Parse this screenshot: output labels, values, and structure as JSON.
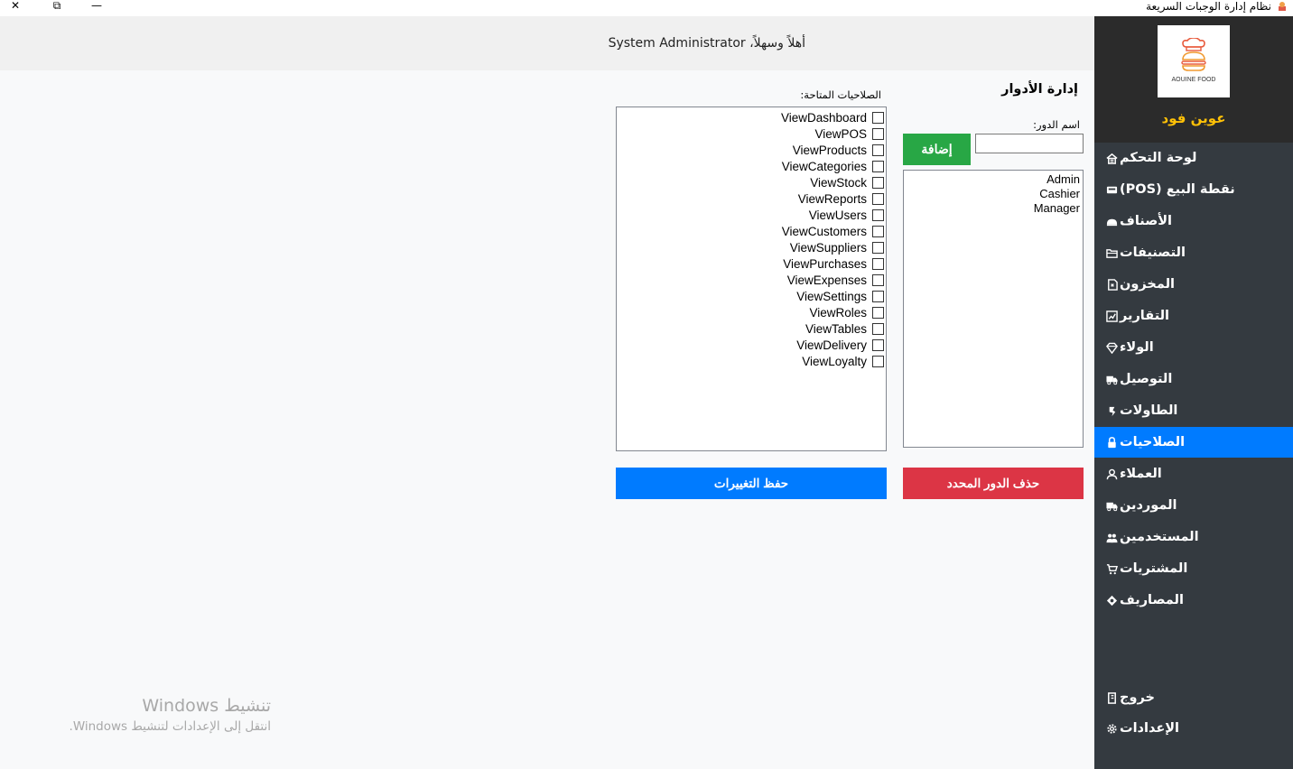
{
  "window": {
    "title": "نظام إدارة الوجبات السريعة",
    "close_glyph": "✕",
    "restore_glyph": "⧉",
    "minimize_glyph": "—"
  },
  "header": {
    "welcome": "أهلاً وسهلاً، System Administrator"
  },
  "sidebar": {
    "logo_text": "AOUINE FOOD",
    "brand": "عوين فود",
    "items": [
      {
        "label": "لوحة التحكم",
        "icon": "home-icon"
      },
      {
        "label": "نقطة البيع (POS)",
        "icon": "pos-icon"
      },
      {
        "label": "الأصناف",
        "icon": "food-icon"
      },
      {
        "label": "التصنيفات",
        "icon": "folder-icon"
      },
      {
        "label": "المخزون",
        "icon": "stock-icon"
      },
      {
        "label": "التقارير",
        "icon": "report-icon"
      },
      {
        "label": "الولاء",
        "icon": "diamond-icon"
      },
      {
        "label": "التوصيل",
        "icon": "truck-icon"
      },
      {
        "label": "الطاولات",
        "icon": "table-icon"
      },
      {
        "label": "الصلاحيات",
        "icon": "lock-icon",
        "active": true
      },
      {
        "label": "العملاء",
        "icon": "user-icon"
      },
      {
        "label": "الموردين",
        "icon": "truck-icon"
      },
      {
        "label": "المستخدمين",
        "icon": "users-icon"
      },
      {
        "label": "المشتريات",
        "icon": "cart-icon"
      },
      {
        "label": "المصاريف",
        "icon": "money-icon"
      }
    ],
    "logout": {
      "label": "خروج",
      "icon": "logout-icon"
    },
    "settings": {
      "label": "الإعدادات",
      "icon": "gear-icon"
    }
  },
  "roles": {
    "title": "إدارة الأدوار",
    "name_label": "اسم الدور:",
    "name_value": "",
    "add_label": "إضافة",
    "items": [
      "Admin",
      "Cashier",
      "Manager"
    ],
    "delete_label": "حذف الدور المحدد"
  },
  "permissions": {
    "title": "الصلاحيات المتاحة:",
    "items": [
      {
        "label": "ViewDashboard",
        "checked": false
      },
      {
        "label": "ViewPOS",
        "checked": false
      },
      {
        "label": "ViewProducts",
        "checked": false
      },
      {
        "label": "ViewCategories",
        "checked": false
      },
      {
        "label": "ViewStock",
        "checked": false
      },
      {
        "label": "ViewReports",
        "checked": false
      },
      {
        "label": "ViewUsers",
        "checked": false
      },
      {
        "label": "ViewCustomers",
        "checked": false
      },
      {
        "label": "ViewSuppliers",
        "checked": false
      },
      {
        "label": "ViewPurchases",
        "checked": false
      },
      {
        "label": "ViewExpenses",
        "checked": false
      },
      {
        "label": "ViewSettings",
        "checked": false
      },
      {
        "label": "ViewRoles",
        "checked": false
      },
      {
        "label": "ViewTables",
        "checked": false
      },
      {
        "label": "ViewDelivery",
        "checked": false
      },
      {
        "label": "ViewLoyalty",
        "checked": false
      }
    ],
    "save_label": "حفظ التغييرات"
  },
  "watermark": {
    "line1": "تنشيط Windows",
    "line2": "انتقل إلى الإعدادات لتنشيط Windows."
  },
  "colors": {
    "sidebar": "#343a40",
    "active": "#007bff",
    "add": "#28a745",
    "delete": "#dc3545",
    "brand": "#ffc107"
  }
}
